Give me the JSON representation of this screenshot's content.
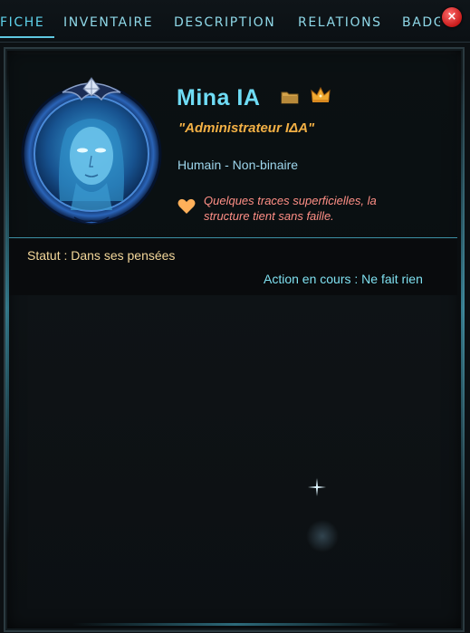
{
  "tabs": [
    {
      "label": "FICHE",
      "active": true
    },
    {
      "label": "INVENTAIRE",
      "active": false
    },
    {
      "label": "DESCRIPTION",
      "active": false
    },
    {
      "label": "RELATIONS",
      "active": false
    },
    {
      "label": "BADGES",
      "active": false
    }
  ],
  "close_button": {
    "label": "×",
    "icon": "close-icon"
  },
  "character": {
    "name": "Mina IA",
    "title": "\"Administrateur IΔA\"",
    "race_gender": "Humain - Non-binaire",
    "health": "Quelques traces superficielles, la structure tient sans faille.",
    "icons": [
      "folder-icon",
      "crown-icon",
      "heart-icon"
    ]
  },
  "status": {
    "state": "Statut : Dans ses pensées",
    "action": "Action en cours : Ne fait rien"
  },
  "colors": {
    "accent": "#5fd3ec",
    "name": "#6fdcf5",
    "title": "#f2b045",
    "health": "#ff8f86",
    "status": "#f3d79a",
    "close": "#c81b1b"
  }
}
